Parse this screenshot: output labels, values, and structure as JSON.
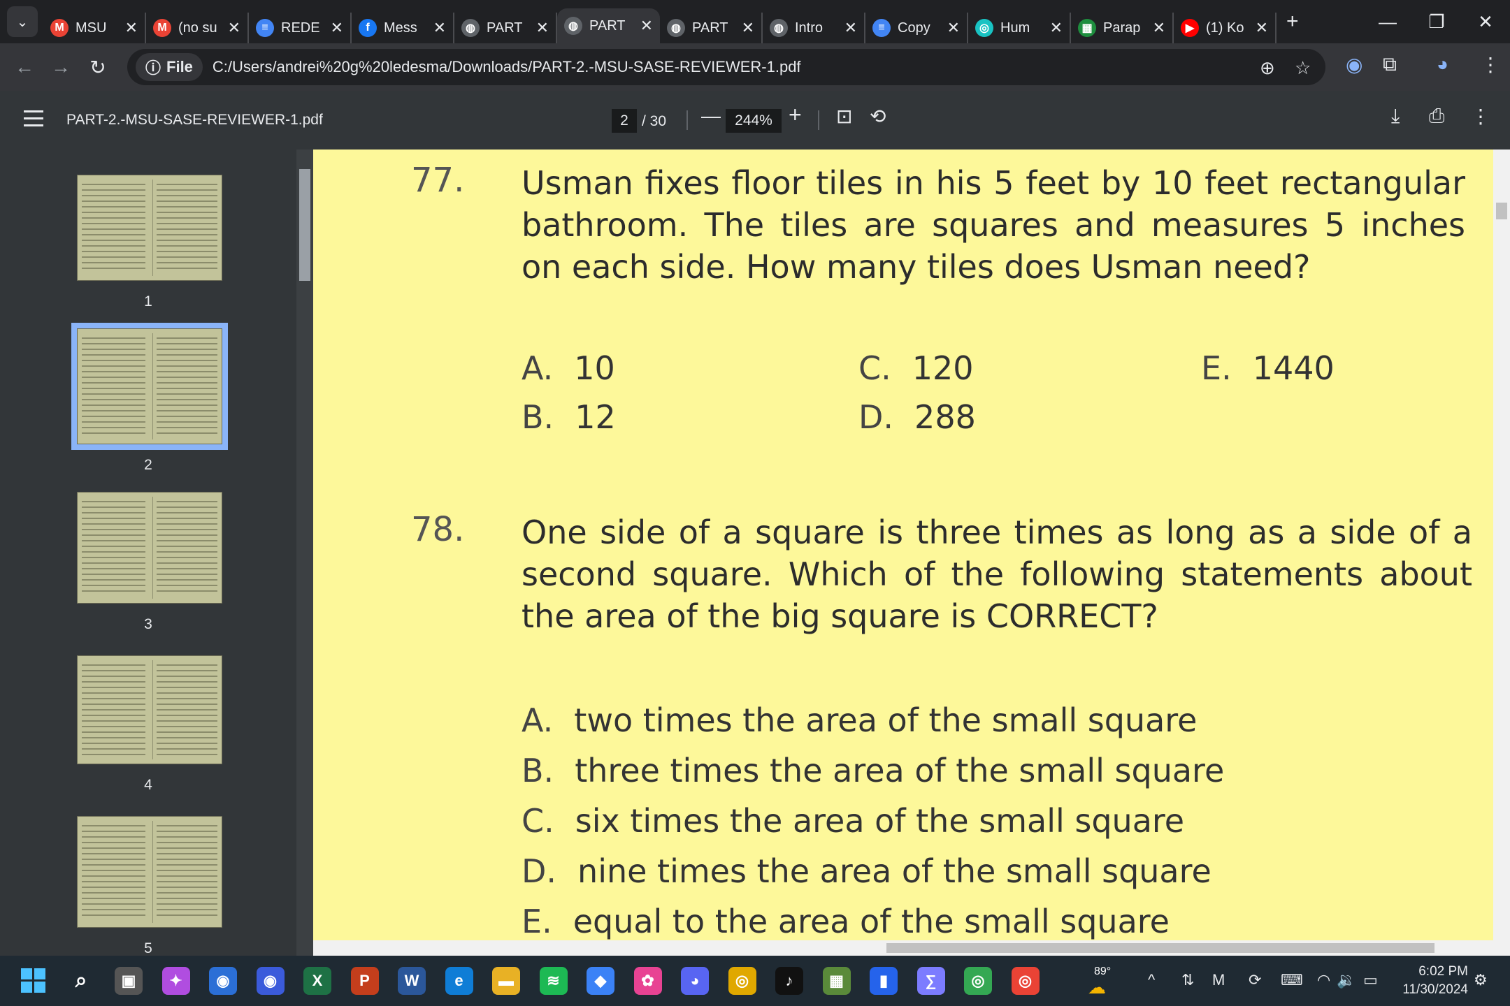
{
  "tabs": [
    {
      "title": "MSU",
      "icon": "gmail-icon",
      "color": "#ea4335",
      "glyph": "M"
    },
    {
      "title": "(no su",
      "icon": "gmail-icon",
      "color": "#ea4335",
      "glyph": "M"
    },
    {
      "title": "REDE",
      "icon": "docs-icon",
      "color": "#4285f4",
      "glyph": "≡"
    },
    {
      "title": "Mess",
      "icon": "facebook-icon",
      "color": "#1877f2",
      "glyph": "f"
    },
    {
      "title": "PART",
      "icon": "globe-icon",
      "color": "#5f6368",
      "glyph": "◍"
    },
    {
      "title": "PART",
      "icon": "globe-icon",
      "color": "#5f6368",
      "glyph": "◍",
      "active": true
    },
    {
      "title": "PART",
      "icon": "globe-icon",
      "color": "#5f6368",
      "glyph": "◍"
    },
    {
      "title": "Intro",
      "icon": "globe-icon",
      "color": "#5f6368",
      "glyph": "◍"
    },
    {
      "title": "Copy",
      "icon": "docs-icon",
      "color": "#4285f4",
      "glyph": "≡"
    },
    {
      "title": "Hum",
      "icon": "humata-icon",
      "color": "#19c3c3",
      "glyph": "◎"
    },
    {
      "title": "Parap",
      "icon": "sheets-icon",
      "color": "#1e8e3e",
      "glyph": "▦"
    },
    {
      "title": "(1) Ko",
      "icon": "youtube-icon",
      "color": "#ff0000",
      "glyph": "▶"
    }
  ],
  "address": {
    "scheme_label": "File",
    "url": "C:/Users/andrei%20g%20ledesma/Downloads/PART-2.-MSU-SASE-REVIEWER-1.pdf"
  },
  "pdf_toolbar": {
    "title": "PART-2.-MSU-SASE-REVIEWER-1.pdf",
    "page_current": "2",
    "page_total": "/ 30",
    "zoom": "244%"
  },
  "thumbnails": [
    "1",
    "2",
    "3",
    "4",
    "5"
  ],
  "questions": {
    "q77": {
      "number": "77.",
      "text": "Usman fixes floor tiles in his 5 feet by 10 feet rectangular bathroom. The tiles are squares and measures 5 inches on each side. How many tiles does Usman need?",
      "options": [
        {
          "letter": "A.",
          "text": "10"
        },
        {
          "letter": "B.",
          "text": "12"
        },
        {
          "letter": "C.",
          "text": "120"
        },
        {
          "letter": "D.",
          "text": "288"
        },
        {
          "letter": "E.",
          "text": "1440"
        }
      ]
    },
    "q78": {
      "number": "78.",
      "text": "One side of a square is three times as long as a side of a second square. Which of the following statements about the area of the big square is CORRECT?",
      "options": [
        {
          "letter": "A.",
          "text": "two times the area of the small square"
        },
        {
          "letter": "B.",
          "text": "three times the area of the small square"
        },
        {
          "letter": "C.",
          "text": "six times the area of the small square"
        },
        {
          "letter": "D.",
          "text": "nine times the area of the small square"
        },
        {
          "letter": "E.",
          "text": "equal to the area of the small square"
        }
      ]
    }
  },
  "taskbar": {
    "weather": "89°",
    "time": "6:02 PM",
    "date": "11/30/2024"
  }
}
